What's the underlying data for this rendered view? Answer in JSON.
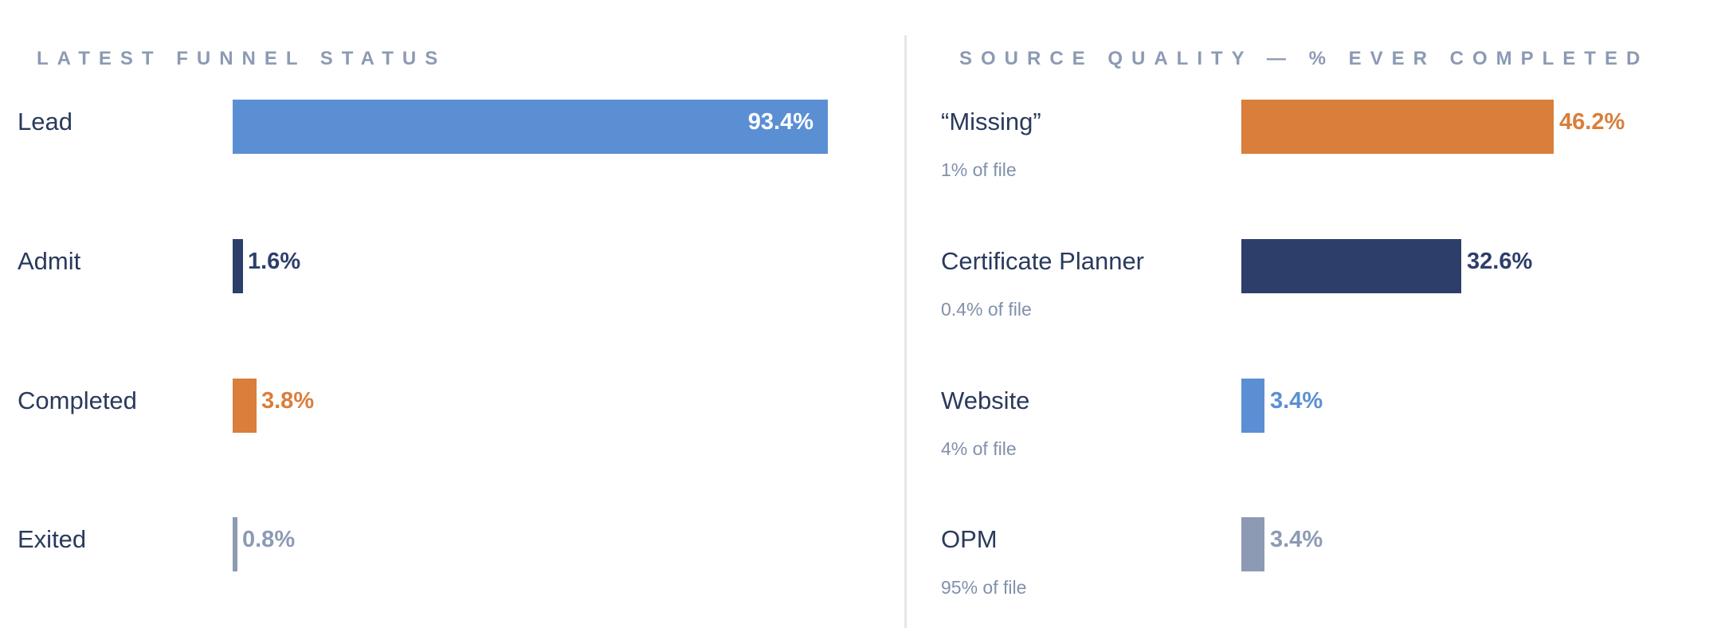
{
  "left_panel": {
    "title": "LATEST FUNNEL STATUS"
  },
  "right_panel": {
    "title": "SOURCE QUALITY — % EVER COMPLETED"
  },
  "chart_data": [
    {
      "type": "bar",
      "orientation": "horizontal",
      "title": "LATEST FUNNEL STATUS",
      "xlim": [
        0,
        100
      ],
      "grid": false,
      "bars": [
        {
          "label": "Lead",
          "value": 93.4,
          "value_label": "93.4%",
          "color": "#5b8fd4",
          "label_inside": true
        },
        {
          "label": "Admit",
          "value": 1.6,
          "value_label": "1.6%",
          "color": "#2d3e6b",
          "label_inside": false
        },
        {
          "label": "Completed",
          "value": 3.8,
          "value_label": "3.8%",
          "color": "#d97e3b",
          "label_inside": false
        },
        {
          "label": "Exited",
          "value": 0.8,
          "value_label": "0.8%",
          "color": "#8c9ab4",
          "label_inside": false
        }
      ]
    },
    {
      "type": "bar",
      "orientation": "horizontal",
      "title": "SOURCE QUALITY — % EVER COMPLETED",
      "xlim": [
        0,
        100
      ],
      "grid": false,
      "bars": [
        {
          "label": "“Missing”",
          "sublabel": "1% of file",
          "value": 46.2,
          "value_label": "46.2%",
          "color": "#d97e3b",
          "label_inside": false
        },
        {
          "label": "Certificate Planner",
          "sublabel": "0.4% of file",
          "value": 32.6,
          "value_label": "32.6%",
          "color": "#2d3e6b",
          "label_inside": false
        },
        {
          "label": "Website",
          "sublabel": "4% of file",
          "value": 3.4,
          "value_label": "3.4%",
          "color": "#5b8fd4",
          "label_inside": false
        },
        {
          "label": "OPM",
          "sublabel": "95% of file",
          "value": 3.4,
          "value_label": "3.4%",
          "color": "#8c9ab4",
          "label_inside": false
        }
      ]
    }
  ]
}
